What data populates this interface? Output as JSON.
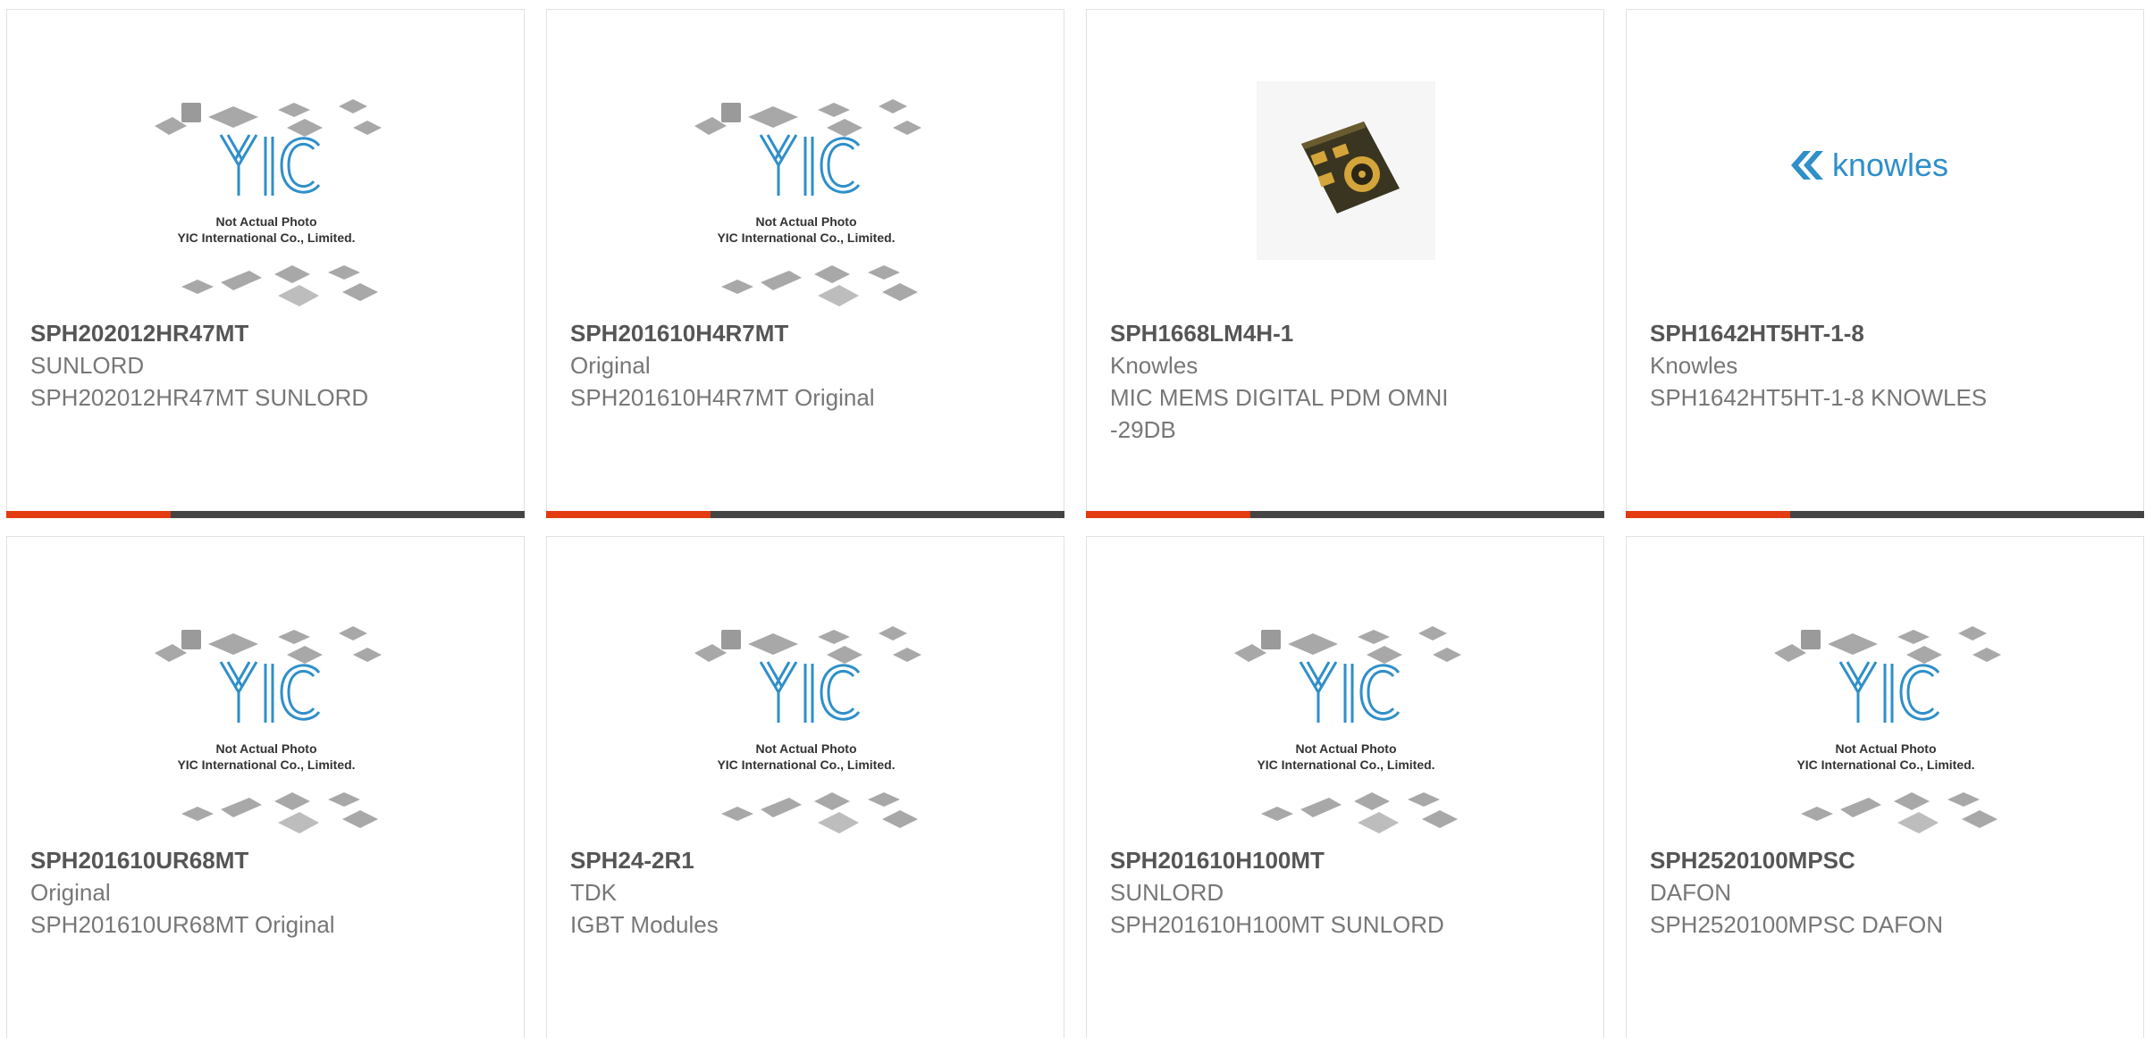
{
  "placeholder": {
    "line1": "Not Actual Photo",
    "line2": "YIC International Co., Limited."
  },
  "knowles_logo_text": "knowles",
  "products": [
    {
      "part": "SPH202012HR47MT",
      "maker": "SUNLORD",
      "desc": "SPH202012HR47MT SUNLORD",
      "image": "placeholder"
    },
    {
      "part": "SPH201610H4R7MT",
      "maker": "Original",
      "desc": "SPH201610H4R7MT Original",
      "image": "placeholder"
    },
    {
      "part": "SPH1668LM4H-1",
      "maker": "Knowles",
      "desc": "MIC MEMS DIGITAL PDM OMNI -29DB",
      "image": "mic-photo"
    },
    {
      "part": "SPH1642HT5HT-1-8",
      "maker": "Knowles",
      "desc": "SPH1642HT5HT-1-8 KNOWLES",
      "image": "knowles-logo"
    },
    {
      "part": "SPH201610UR68MT",
      "maker": "Original",
      "desc": "SPH201610UR68MT Original",
      "image": "placeholder"
    },
    {
      "part": "SPH24-2R1",
      "maker": "TDK",
      "desc": "IGBT Modules",
      "image": "placeholder"
    },
    {
      "part": "SPH201610H100MT",
      "maker": "SUNLORD",
      "desc": "SPH201610H100MT SUNLORD",
      "image": "placeholder"
    },
    {
      "part": "SPH2520100MPSC",
      "maker": "DAFON",
      "desc": "SPH2520100MPSC DAFON",
      "image": "placeholder"
    }
  ],
  "colors": {
    "accent": "#e33b12",
    "bar": "#444444",
    "logo_blue": "#2f8fc9"
  }
}
